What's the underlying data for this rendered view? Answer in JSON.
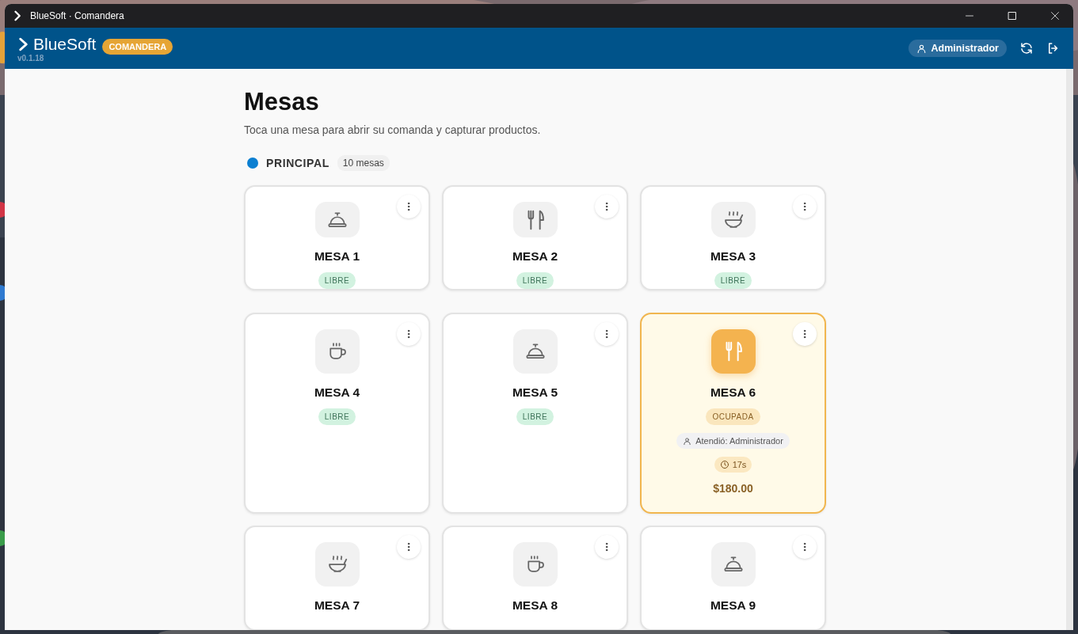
{
  "window": {
    "title": "BlueSoft · Comandera"
  },
  "header": {
    "logo": "BlueSoft",
    "version": "v0.1.18",
    "badge": "COMANDERA",
    "user": "Administrador"
  },
  "page": {
    "title": "Mesas",
    "subtitle": "Toca una mesa para abrir su comanda y capturar productos."
  },
  "section": {
    "name": "PRINCIPAL",
    "color": "#0b7fd1",
    "count": "10 mesas"
  },
  "tables": [
    {
      "name": "MESA 1",
      "status": {
        "kind": "libre",
        "label": "LIBRE"
      }
    },
    {
      "name": "MESA 2",
      "status": {
        "kind": "libre",
        "label": "LIBRE"
      }
    },
    {
      "name": "MESA 3",
      "status": {
        "kind": "libre",
        "label": "LIBRE"
      }
    },
    {
      "name": "MESA 4",
      "status": {
        "kind": "libre",
        "label": "LIBRE"
      }
    },
    {
      "name": "MESA 5",
      "status": {
        "kind": "libre",
        "label": "LIBRE"
      }
    },
    {
      "name": "MESA 6",
      "status": {
        "kind": "ocupada",
        "label": "OCUPADA"
      },
      "waiter": "Atendió: Administrador",
      "elapsed": "17s",
      "total": "$180.00"
    },
    {
      "name": "MESA 7"
    },
    {
      "name": "MESA 8"
    },
    {
      "name": "MESA 9"
    }
  ]
}
